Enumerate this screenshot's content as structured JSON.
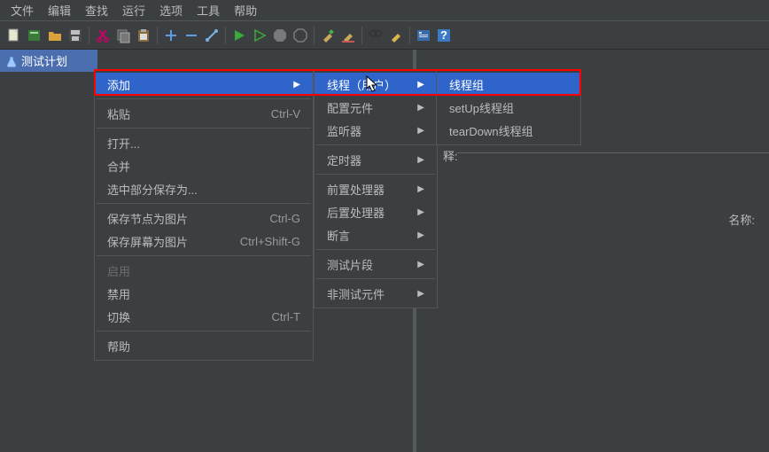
{
  "menubar": [
    "文件",
    "编辑",
    "查找",
    "运行",
    "选项",
    "工具",
    "帮助"
  ],
  "tree": {
    "root": "测试计划"
  },
  "labels": {
    "name": "名称:",
    "explain": "释:"
  },
  "menu1": {
    "add": "添加",
    "paste": "粘贴",
    "paste_sc": "Ctrl-V",
    "open": "打开...",
    "merge": "合并",
    "saveSel": "选中部分保存为...",
    "saveNodeImg": "保存节点为图片",
    "saveNodeImg_sc": "Ctrl-G",
    "saveScreenImg": "保存屏幕为图片",
    "saveScreenImg_sc": "Ctrl+Shift-G",
    "enable": "启用",
    "disable": "禁用",
    "toggle": "切换",
    "toggle_sc": "Ctrl-T",
    "help": "帮助"
  },
  "menu2": {
    "threads": "线程（用户）",
    "config": "配置元件",
    "listener": "监听器",
    "timer": "定时器",
    "pre": "前置处理器",
    "post": "后置处理器",
    "assert": "断言",
    "frag": "测试片段",
    "nontest": "非测试元件"
  },
  "menu3": {
    "tg": "线程组",
    "setup": "setUp线程组",
    "teardown": "tearDown线程组"
  }
}
